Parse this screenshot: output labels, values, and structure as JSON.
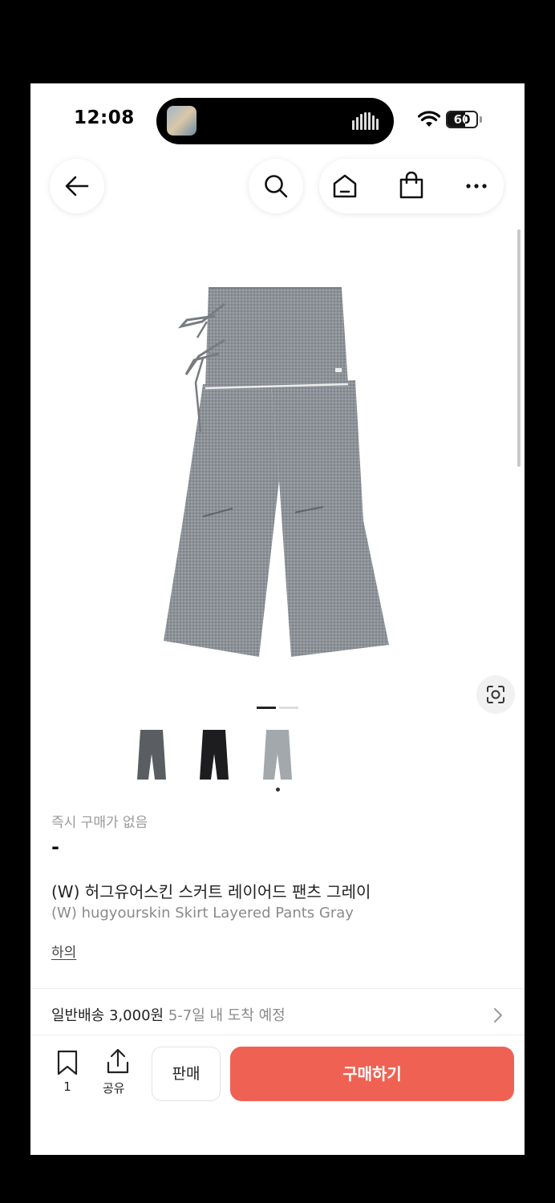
{
  "status_bar": {
    "time": "12:08",
    "battery": "60",
    "battery_level": 0.6,
    "icons": [
      "now-playing-thumbnail",
      "audio-bars-icon",
      "wifi-icon",
      "battery-icon"
    ]
  },
  "nav": {
    "icons": [
      "back-arrow-icon",
      "search-icon",
      "home-icon",
      "shopping-bag-icon",
      "more-icon"
    ]
  },
  "gallery": {
    "image_description_icon": "camera-scan-icon",
    "thumbnails": [
      {
        "color": "#5a5e63"
      },
      {
        "color": "#1d1d1f"
      },
      {
        "color": "#a3a8ad"
      }
    ],
    "selected_index": 2
  },
  "product": {
    "instant_label": "즉시 구매가 없음",
    "price": "-",
    "title_ko": "(W) 허그유어스킨 스커트 레이어드 팬츠 그레이",
    "title_en": "(W) hugyourskin Skirt Layered Pants Gray",
    "category": "하의"
  },
  "shipping": {
    "method": "일반배송",
    "fee": "3,000원",
    "eta": "5-7일 내 도착 예정"
  },
  "bottom_bar": {
    "bookmark_count": "1",
    "share_label": "공유",
    "sell_label": "판매",
    "buy_label": "구매하기"
  },
  "colors": {
    "buy_button": "#ef6253",
    "background": "#ffffff"
  }
}
